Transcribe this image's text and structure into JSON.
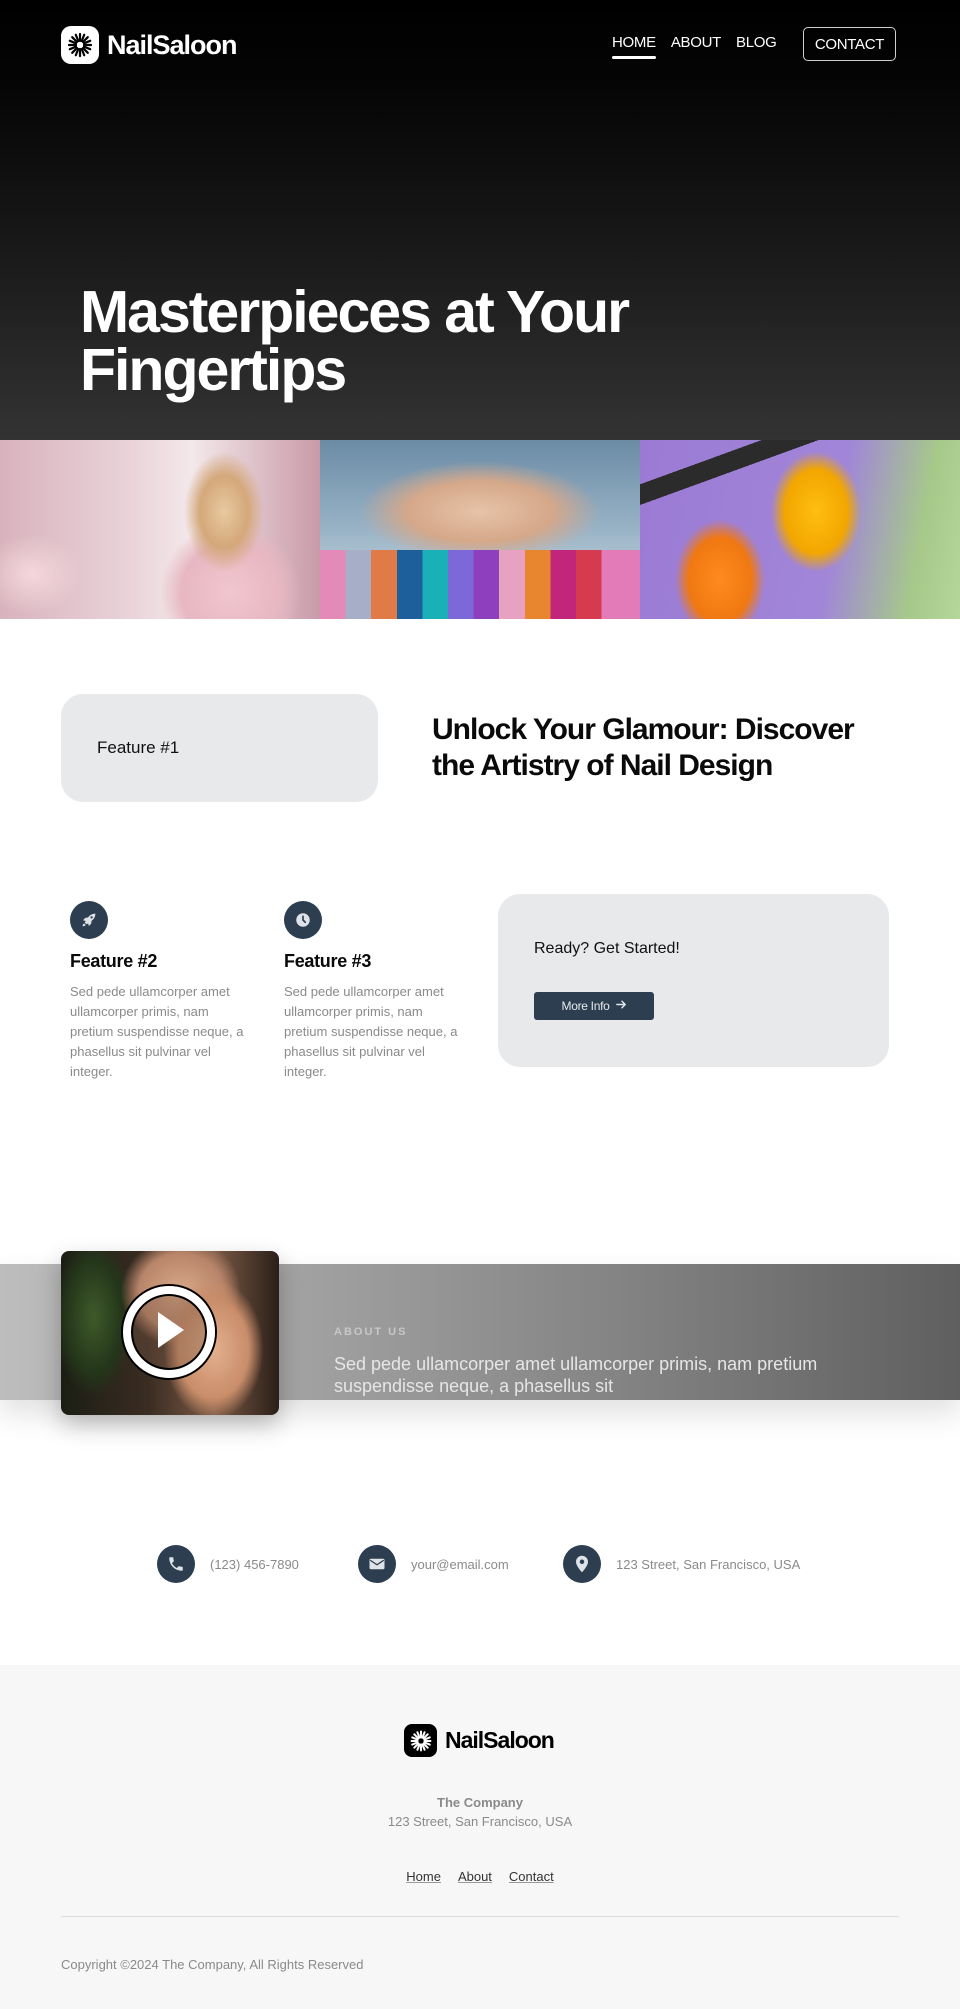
{
  "brand": {
    "name": "NailSaloon",
    "logo_icon": "sunburst-icon"
  },
  "nav": {
    "items": [
      {
        "label": "HOME",
        "active": true
      },
      {
        "label": "ABOUT",
        "active": false
      },
      {
        "label": "BLOG",
        "active": false
      }
    ],
    "contact_label": "CONTACT"
  },
  "hero": {
    "title": "Masterpieces at Your Fingertips"
  },
  "gallery": {
    "images": [
      {
        "alt": "Woman doing manicure in pink salon"
      },
      {
        "alt": "Hands painting nails over colorful polish bottles"
      },
      {
        "alt": "OPI nail lacquer bottles in orange and yellow"
      }
    ]
  },
  "feature1": {
    "label": "Feature #1",
    "heading": "Unlock Your Glamour: Discover the Artistry of Nail Design"
  },
  "features": [
    {
      "icon": "rocket-icon",
      "title": "Feature #2",
      "body": "Sed pede ullamcorper amet ullamcorper primis, nam pretium suspendisse neque, a phasellus sit pulvinar vel integer."
    },
    {
      "icon": "clock-icon",
      "title": "Feature #3",
      "body": "Sed pede ullamcorper amet ullamcorper primis, nam pretium suspendisse neque, a phasellus sit pulvinar vel integer."
    }
  ],
  "cta": {
    "title": "Ready? Get Started!",
    "button_label": "More Info",
    "button_icon": "arrow-right-icon"
  },
  "about": {
    "label": "ABOUT US",
    "text": "Sed pede ullamcorper amet ullamcorper primis, nam pretium suspendisse neque, a phasellus sit",
    "video_icon": "play-icon"
  },
  "contact": {
    "phone": "(123) 456-7890",
    "email": "your@email.com",
    "address": "123 Street, San Francisco, USA"
  },
  "footer": {
    "company": "The Company",
    "address": "123 Street, San Francisco, USA",
    "links": [
      "Home",
      "About",
      "Contact"
    ],
    "copyright": "Copyright ©2024 The Company, All Rights Reserved"
  },
  "colors": {
    "accent": "#2c3e50",
    "card_bg": "#e8e9eb",
    "footer_bg": "#f7f7f7",
    "muted_text": "#8a8a8a"
  }
}
